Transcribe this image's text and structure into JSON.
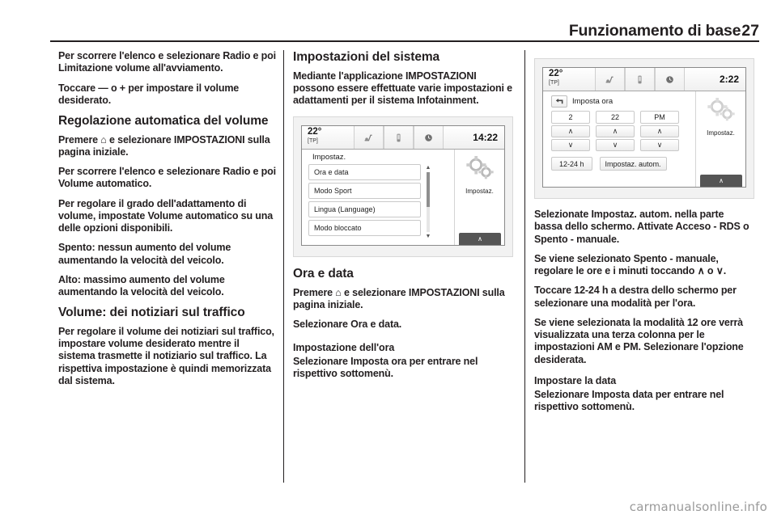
{
  "header": {
    "title": "Funzionamento di base",
    "page_number": "27"
  },
  "column1": {
    "p_scroll_radio": "Per scorrere l'elenco e selezionare Radio e poi Limitazione volume all'avviamento.",
    "p_touch_minus_plus": "Toccare — o + per impostare il volume desiderato.",
    "h_auto_volume": "Regolazione automatica del volume",
    "p_press_home": "Premere ⌂ e selezionare IMPOSTAZIONI sulla pagina iniziale.",
    "p_scroll_auto": "Per scorrere l'elenco e selezionare Radio e poi Volume automatico.",
    "p_adjust_degree": "Per regolare il grado dell'adattamento di volume, impostate Volume automatico su una delle opzioni disponibili.",
    "p_off_option": "Spento: nessun aumento del volume aumentando la velocità del veicolo.",
    "p_high_option": "Alto: massimo aumento del volume aumentando la velocità del veicolo.",
    "h_traffic_volume": "Volume: dei notiziari sul traffico",
    "p_traffic_body": "Per regolare il volume dei notiziari sul traffico, impostare volume desiderato mentre il sistema trasmette il notiziario sul traffico. La rispettiva impostazione è quindi memorizzata dal sistema."
  },
  "column2": {
    "h_system_settings": "Impostazioni del sistema",
    "p_intro": "Mediante l'applicazione IMPOSTAZIONI possono essere effettuate varie impostazioni e adattamenti per il sistema Infotainment.",
    "h_time_date": "Ora e data",
    "p_press_home": "Premere ⌂ e selezionare IMPOSTAZIONI sulla pagina iniziale.",
    "p_select_time_date": "Selezionare Ora e data.",
    "h_set_time": "Impostazione dell'ora",
    "p_set_time_body": "Selezionare Imposta ora per entrare nel rispettivo sottomenù."
  },
  "column3": {
    "p_select_auto": "Selezionate Impostaz. autom. nella parte bassa dello schermo. Attivate Acceso - RDS o Spento - manuale.",
    "p_manual_mode": "Se viene selezionato Spento - manuale, regolare le ore e i minuti toccando ∧ o ∨.",
    "p_12_24": "Toccare 12-24 h a destra dello schermo per selezionare una modalità per l'ora.",
    "p_am_pm": "Se viene selezionata la modalità 12 ore verrà visualizzata una terza colonna per le impostazioni AM e PM. Selezionare l'opzione desiderata.",
    "h_set_date": "Impostare la data",
    "p_set_date_body": "Selezionare Imposta data per entrare nel rispettivo sottomenù."
  },
  "screenshot_settings": {
    "statusbar": {
      "temperature": "22°",
      "tp_label": "[TP]",
      "icon1": "audio-source-icon",
      "icon2": "phone-icon",
      "icon3": "clock-icon",
      "time": "14:22"
    },
    "menu_title": "Impostaz.",
    "list_items": [
      "Ora e data",
      "Modo Sport",
      "Lingua (Language)",
      "Modo bloccato"
    ],
    "side_label": "Impostaz.",
    "side_icon": "gears-icon",
    "scroll_up": "▲",
    "scroll_down": "▼",
    "bottom_tab": "∧"
  },
  "screenshot_clock": {
    "statusbar": {
      "temperature": "22°",
      "tp_label": "[TP]",
      "icon1": "audio-source-icon",
      "icon2": "phone-icon",
      "icon3": "clock-icon",
      "time": "2:22"
    },
    "back_icon": "back-arrow-icon",
    "title": "Imposta ora",
    "steppers": [
      {
        "value": "2",
        "up": "∧",
        "down": "∨"
      },
      {
        "value": "22",
        "up": "∧",
        "down": "∨"
      },
      {
        "value": "PM",
        "up": "∧",
        "down": "∨"
      }
    ],
    "button_format": "12-24 h",
    "button_auto": "Impostaz. autom.",
    "side_label": "Impostaz.",
    "side_icon": "gears-icon",
    "bottom_tab": "∧"
  },
  "watermark": "carmanualsonline.info"
}
